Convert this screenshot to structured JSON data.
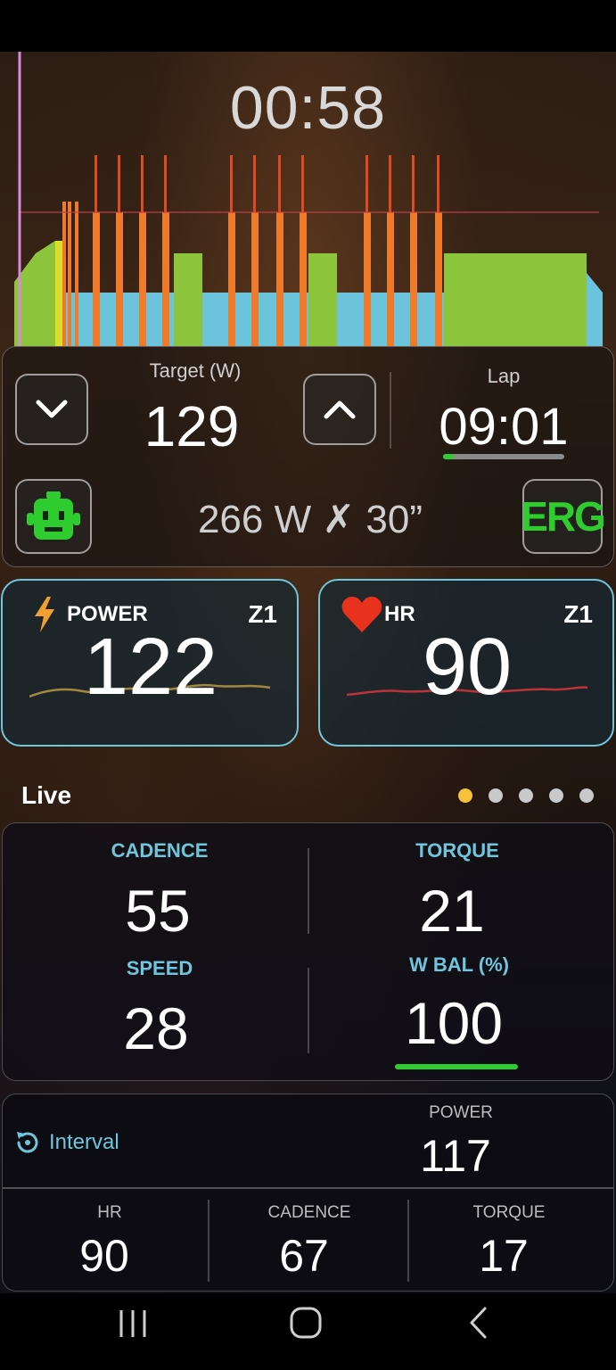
{
  "timer": "00:58",
  "control": {
    "target_label": "Target (W)",
    "target_value": "129",
    "lap_label": "Lap",
    "lap_value": "09:01",
    "lap_progress": 0.09,
    "interval_text": "266 W ✗ 30”",
    "erg_label": "ERG"
  },
  "power_card": {
    "label": "POWER",
    "zone": "Z1",
    "value": "122"
  },
  "hr_card": {
    "label": "HR",
    "zone": "Z1",
    "value": "90"
  },
  "live": {
    "title": "Live",
    "page_count": 5,
    "active_page": 1
  },
  "stats": {
    "cadence_label": "CADENCE",
    "cadence_value": "55",
    "torque_label": "TORQUE",
    "torque_value": "21",
    "speed_label": "SPEED",
    "speed_value": "28",
    "wbal_label": "W BAL (%)",
    "wbal_value": "100",
    "wbal_progress": 1.0
  },
  "interval": {
    "label": "Interval",
    "power_label": "POWER",
    "power_value": "117",
    "hr_label": "HR",
    "hr_value": "90",
    "cadence_label": "CADENCE",
    "cadence_value": "67",
    "torque_label": "TORQUE",
    "torque_value": "17"
  },
  "colors": {
    "accent_cyan": "#6fc6dc",
    "accent_green": "#2ecc2e",
    "heart_red": "#e8321e",
    "bolt_orange": "#f0a030",
    "page_dot_active": "#f5c23a"
  }
}
